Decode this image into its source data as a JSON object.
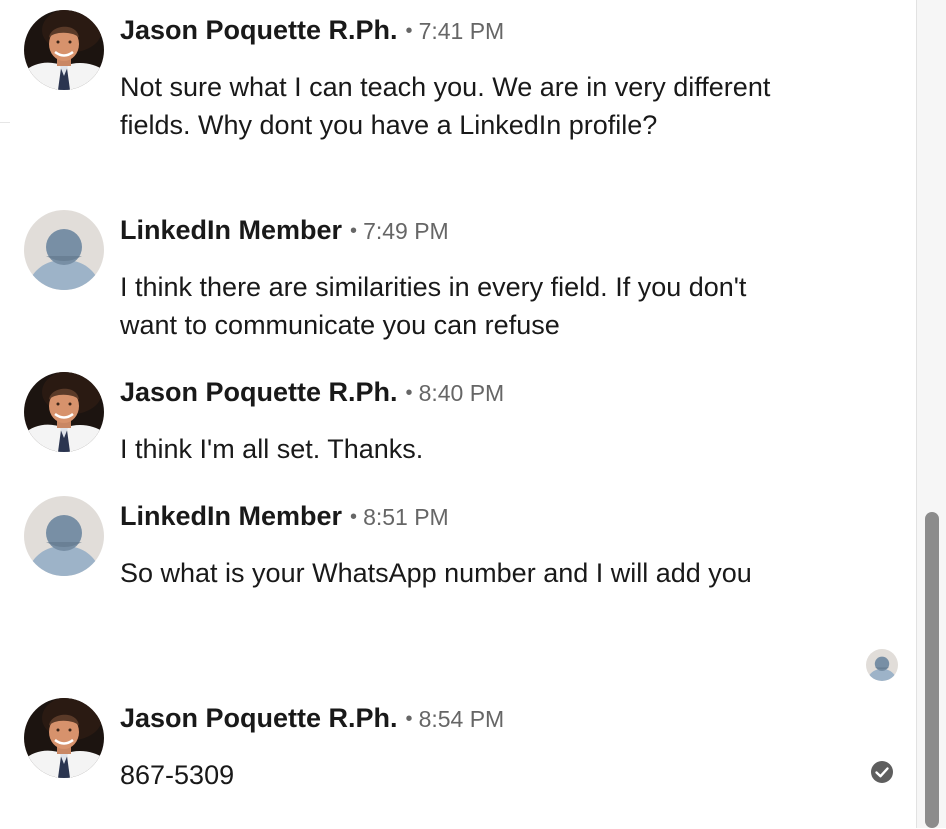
{
  "messages": [
    {
      "sender": "Jason Poquette R.Ph.",
      "separator": "•",
      "time": "7:41 PM",
      "text": "Not sure what I can teach you. We are in very different fields. Why dont you have a LinkedIn profile?",
      "avatar_icon": "profile-photo"
    },
    {
      "sender": "LinkedIn Member",
      "separator": "•",
      "time": "7:49 PM",
      "text": "I think there are similarities in every field. If you don't want to communicate you can refuse",
      "avatar_icon": "default-member-icon"
    },
    {
      "sender": "Jason Poquette R.Ph.",
      "separator": "•",
      "time": "8:40 PM",
      "text": "I think I'm all set. Thanks.",
      "avatar_icon": "profile-photo"
    },
    {
      "sender": "LinkedIn Member",
      "separator": "•",
      "time": "8:51 PM",
      "text": "So what is your WhatsApp number and I will add you",
      "avatar_icon": "default-member-icon"
    },
    {
      "sender": "Jason Poquette R.Ph.",
      "separator": "•",
      "time": "8:54 PM",
      "text": "867-5309",
      "avatar_icon": "profile-photo"
    }
  ],
  "read_receipt_icon": "default-member-icon",
  "sent_status_icon": "check-circle-icon",
  "colors": {
    "text": "#191919",
    "meta": "#666666",
    "default_avatar_bg": "#e1ddd9",
    "default_avatar_figure": "#9db3c8",
    "scroll_thumb": "#8c8c8c"
  }
}
